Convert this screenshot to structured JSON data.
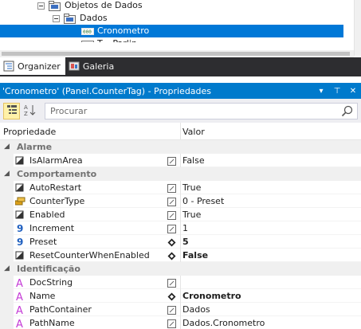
{
  "tree": {
    "items": [
      {
        "label": "Objetos de Dados"
      },
      {
        "label": "Dados"
      },
      {
        "label": "Cronometro"
      },
      {
        "label": "T... Parlin..."
      }
    ]
  },
  "tabs": [
    {
      "label": "Organizer",
      "icon": "organizer-icon"
    },
    {
      "label": "Galeria",
      "icon": "gallery-icon"
    }
  ],
  "properties_panel": {
    "title": "'Cronometro' (Panel.CounterTag) - Propriedades",
    "controls": {
      "dropdown": "▾",
      "pin": "⊤",
      "close": "✕"
    }
  },
  "toolbar": {
    "search_placeholder": "Procurar"
  },
  "grid": {
    "header": {
      "property": "Propriedade",
      "value": "Valor"
    },
    "categories": [
      {
        "name": "Alarme",
        "properties": [
          {
            "name": "IsAlarmArea",
            "value": "False",
            "icon": "boolean-icon",
            "bold": false
          }
        ]
      },
      {
        "name": "Comportamento",
        "properties": [
          {
            "name": "AutoRestart",
            "value": "True",
            "icon": "boolean-icon",
            "bold": false
          },
          {
            "name": "CounterType",
            "value": "0 - Preset",
            "icon": "enum-icon",
            "bold": false
          },
          {
            "name": "Enabled",
            "value": "True",
            "icon": "boolean-icon",
            "bold": false
          },
          {
            "name": "Increment",
            "value": "1",
            "icon": "number-icon",
            "bold": false
          },
          {
            "name": "Preset",
            "value": "5",
            "icon": "number-icon",
            "bold": true
          },
          {
            "name": "ResetCounterWhenEnabled",
            "value": "False",
            "icon": "boolean-icon",
            "bold": true
          }
        ]
      },
      {
        "name": "Identificação",
        "properties": [
          {
            "name": "DocString",
            "value": "",
            "icon": "string-icon",
            "bold": false
          },
          {
            "name": "Name",
            "value": "Cronometro",
            "icon": "string-icon",
            "bold": true
          },
          {
            "name": "PathContainer",
            "value": "Dados",
            "icon": "string-icon",
            "bold": false
          },
          {
            "name": "PathName",
            "value": "Dados.Cronometro",
            "icon": "string-icon",
            "bold": false
          }
        ]
      }
    ]
  },
  "colors": {
    "selection": "#0078d7",
    "title_bar": "#007acc",
    "tab_bar": "#2d2d30",
    "category_bg": "#f0f0f0",
    "number_icon": "#1f5fbf",
    "string_icon": "#c43ad6"
  }
}
